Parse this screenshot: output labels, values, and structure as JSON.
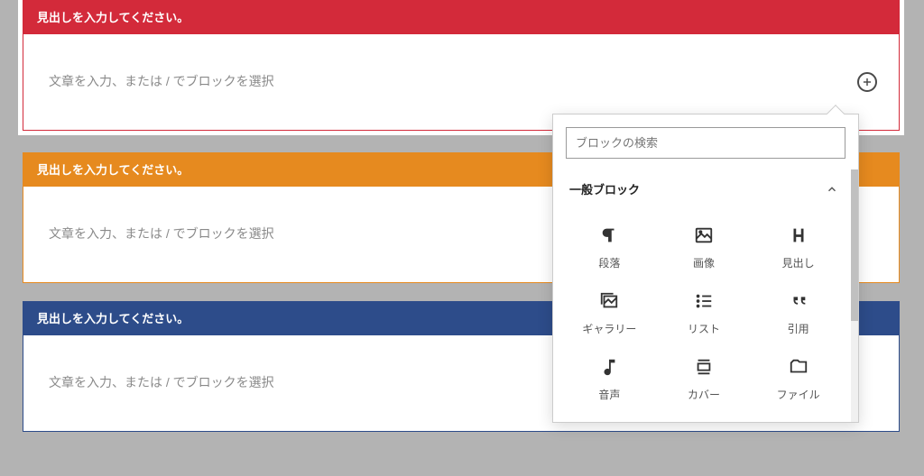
{
  "blocks": [
    {
      "heading_placeholder": "見出しを入力してください。",
      "content_placeholder": "文章を入力、または / でブロックを選択",
      "color": "red",
      "active": true
    },
    {
      "heading_placeholder": "見出しを入力してください。",
      "content_placeholder": "文章を入力、または / でブロックを選択",
      "color": "orange",
      "active": false
    },
    {
      "heading_placeholder": "見出しを入力してください。",
      "content_placeholder": "文章を入力、または / でブロックを選択",
      "color": "blue",
      "active": false
    }
  ],
  "popover": {
    "search_placeholder": "ブロックの検索",
    "category_label": "一般ブロック",
    "items": [
      {
        "label": "段落",
        "icon": "paragraph-icon"
      },
      {
        "label": "画像",
        "icon": "image-icon"
      },
      {
        "label": "見出し",
        "icon": "heading-icon"
      },
      {
        "label": "ギャラリー",
        "icon": "gallery-icon"
      },
      {
        "label": "リスト",
        "icon": "list-icon"
      },
      {
        "label": "引用",
        "icon": "quote-icon"
      },
      {
        "label": "音声",
        "icon": "audio-icon"
      },
      {
        "label": "カバー",
        "icon": "cover-icon"
      },
      {
        "label": "ファイル",
        "icon": "file-icon"
      }
    ]
  }
}
